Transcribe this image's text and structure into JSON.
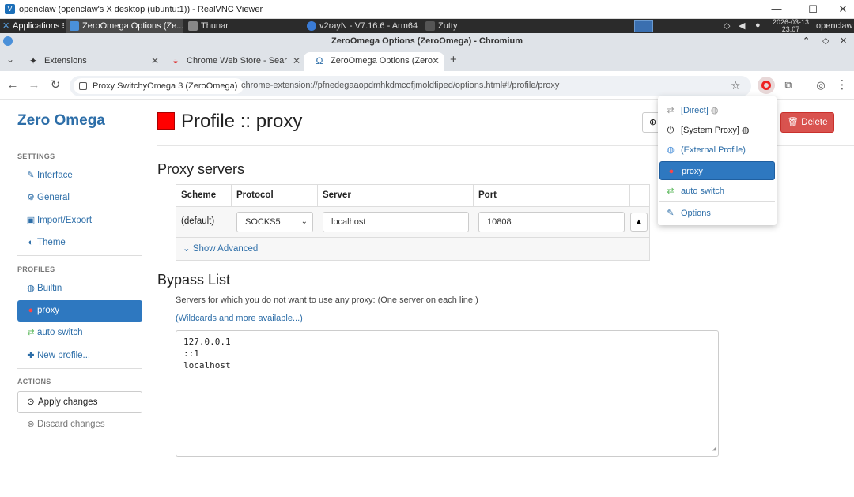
{
  "vnc": {
    "title": "openclaw (openclaw's X desktop (ubuntu:1)) - RealVNC Viewer",
    "minimize": "—",
    "maximize": "☐",
    "close": "✕"
  },
  "panel": {
    "applications": "Applications",
    "applications_arrow": "⁝",
    "tasks": [
      {
        "label": "ZeroOmega Options (Ze..."
      },
      {
        "label": "Thunar"
      },
      {
        "label": "v2rayN - V7.16.6 - Arm64"
      },
      {
        "label": "Zutty"
      }
    ],
    "date": "2026-03-13",
    "time": "23:07",
    "user": "openclaw"
  },
  "chromium": {
    "window_title": "ZeroOmega Options (ZeroOmega) - Chromium",
    "tabs": [
      {
        "label": "Extensions"
      },
      {
        "label": "Chrome Web Store - Sear"
      },
      {
        "label": "ZeroOmega Options (Zero"
      }
    ],
    "new_tab": "+",
    "tab_list": "⌄",
    "omnibox_chip": "Proxy SwitchyOmega 3 (ZeroOmega)",
    "url": "chrome-extension://pfnedegaaopdmhkdmcofjmoldfiped/options.html#!/profile/proxy"
  },
  "app": {
    "brand": "Zero Omega",
    "settings_heading": "SETTINGS",
    "settings_items": [
      {
        "label": "Interface"
      },
      {
        "label": "General"
      },
      {
        "label": "Import/Export"
      },
      {
        "label": "Theme"
      }
    ],
    "profiles_heading": "PROFILES",
    "profile_items": [
      {
        "label": "Builtin"
      },
      {
        "label": "proxy"
      },
      {
        "label": "auto switch"
      },
      {
        "label": "New profile..."
      }
    ],
    "actions_heading": "ACTIONS",
    "apply_label": "Apply changes",
    "discard_label": "Discard changes"
  },
  "profile": {
    "title": "Profile :: proxy",
    "color": "#ff0000",
    "delete_label": "Delete",
    "proxy_servers_heading": "Proxy servers",
    "columns": [
      "Scheme",
      "Protocol",
      "Server",
      "Port"
    ],
    "row": {
      "scheme": "(default)",
      "protocol": "SOCKS5",
      "server": "localhost",
      "port": "10808"
    },
    "show_advanced": "Show Advanced",
    "bypass_heading": "Bypass List",
    "bypass_help": "Servers for which you do not want to use any proxy: (One server on each line.)",
    "bypass_link": "(Wildcards and more available...)",
    "bypass_lines": [
      "127.0.0.1",
      "::1",
      "localhost"
    ]
  },
  "popup_menu": {
    "items": [
      {
        "label": "[Direct]"
      },
      {
        "label": "[System Proxy]"
      },
      {
        "label": "(External Profile)"
      },
      {
        "label": "proxy"
      },
      {
        "label": "auto switch"
      },
      {
        "label": "Options"
      }
    ]
  },
  "colors": {
    "accent": "#2e78c0",
    "link": "#2d6ea8",
    "danger": "#d9534f",
    "profile_color": "#ff0000"
  }
}
